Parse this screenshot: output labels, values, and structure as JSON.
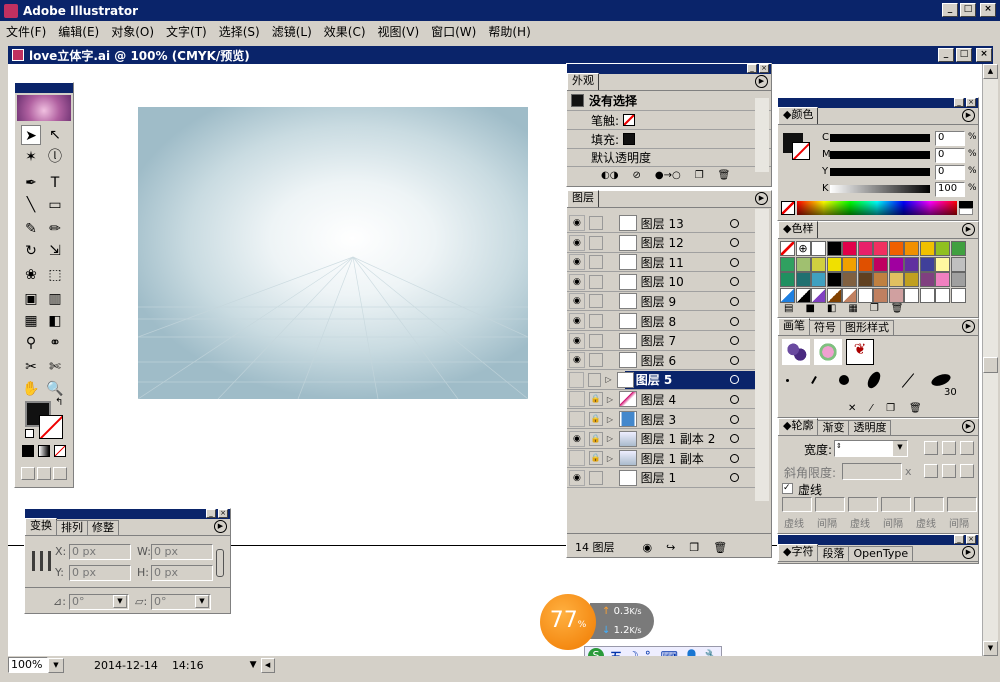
{
  "app": {
    "title": "Adobe Illustrator"
  },
  "menu": [
    "文件(F)",
    "编辑(E)",
    "对象(O)",
    "文字(T)",
    "选择(S)",
    "滤镜(L)",
    "效果(C)",
    "视图(V)",
    "窗口(W)",
    "帮助(H)"
  ],
  "document": {
    "title": "love立体字.ai @ 100% (CMYK/预览)"
  },
  "appearance": {
    "tab": "外观",
    "no_selection": "没有选择",
    "stroke_label": "笔触:",
    "fill_label": "填充:",
    "opacity": "默认透明度"
  },
  "layers": {
    "tab": "图层",
    "items": [
      {
        "name": "图层 13",
        "visible": true,
        "locked": false,
        "selected": false
      },
      {
        "name": "图层 12",
        "visible": true,
        "locked": false,
        "selected": false
      },
      {
        "name": "图层 11",
        "visible": true,
        "locked": false,
        "selected": false
      },
      {
        "name": "图层 10",
        "visible": true,
        "locked": false,
        "selected": false
      },
      {
        "name": "图层 9",
        "visible": true,
        "locked": false,
        "selected": false
      },
      {
        "name": "图层 8",
        "visible": true,
        "locked": false,
        "selected": false
      },
      {
        "name": "图层 7",
        "visible": true,
        "locked": false,
        "selected": false
      },
      {
        "name": "图层 6",
        "visible": true,
        "locked": false,
        "selected": false
      },
      {
        "name": "图层 5",
        "visible": false,
        "locked": false,
        "selected": true
      },
      {
        "name": "图层 4",
        "visible": false,
        "locked": true,
        "selected": false
      },
      {
        "name": "图层 3",
        "visible": false,
        "locked": true,
        "selected": false
      },
      {
        "name": "图层 1 副本 2",
        "visible": true,
        "locked": true,
        "selected": false
      },
      {
        "name": "图层 1 副本",
        "visible": false,
        "locked": true,
        "selected": false
      },
      {
        "name": "图层 1",
        "visible": true,
        "locked": false,
        "selected": false
      }
    ],
    "count": "14 图层"
  },
  "color": {
    "tab": "颜色",
    "channels": [
      {
        "label": "C",
        "value": "0"
      },
      {
        "label": "M",
        "value": "0"
      },
      {
        "label": "Y",
        "value": "0"
      },
      {
        "label": "K",
        "value": "100"
      }
    ],
    "unit": "%"
  },
  "swatches": {
    "tab": "色样"
  },
  "brushes": {
    "tabs": [
      "画笔",
      "符号",
      "图形样式"
    ],
    "size_label": "30"
  },
  "stroke": {
    "tabs": [
      "轮廓",
      "渐变",
      "透明度"
    ],
    "width_label": "宽度:",
    "miter_label": "斜角限度:",
    "miter_unit": "x",
    "dashed_label": "虚线",
    "dash_labels": [
      "虚线",
      "间隔",
      "虚线",
      "间隔",
      "虚线",
      "间隔"
    ]
  },
  "character": {
    "tabs": [
      "字符",
      "段落",
      "OpenType"
    ]
  },
  "transform": {
    "tabs": [
      "变换",
      "排列",
      "修整"
    ],
    "x_label": "X:",
    "y_label": "Y:",
    "w_label": "W:",
    "h_label": "H:",
    "x": "0 px",
    "y": "0 px",
    "w": "0 px",
    "h": "0 px",
    "rotate": "0°",
    "shear": "0°"
  },
  "status": {
    "zoom": "100%",
    "date": "2014-12-14",
    "time": "14:16"
  },
  "netwidget": {
    "percent": "77",
    "percent_unit": "%",
    "up": "0.3",
    "down": "1.2",
    "unit": "K/s"
  },
  "colors": {
    "title_bar": "#0a246a",
    "selected_layer": "#0a246a",
    "chrome": "#d4d0c8"
  }
}
